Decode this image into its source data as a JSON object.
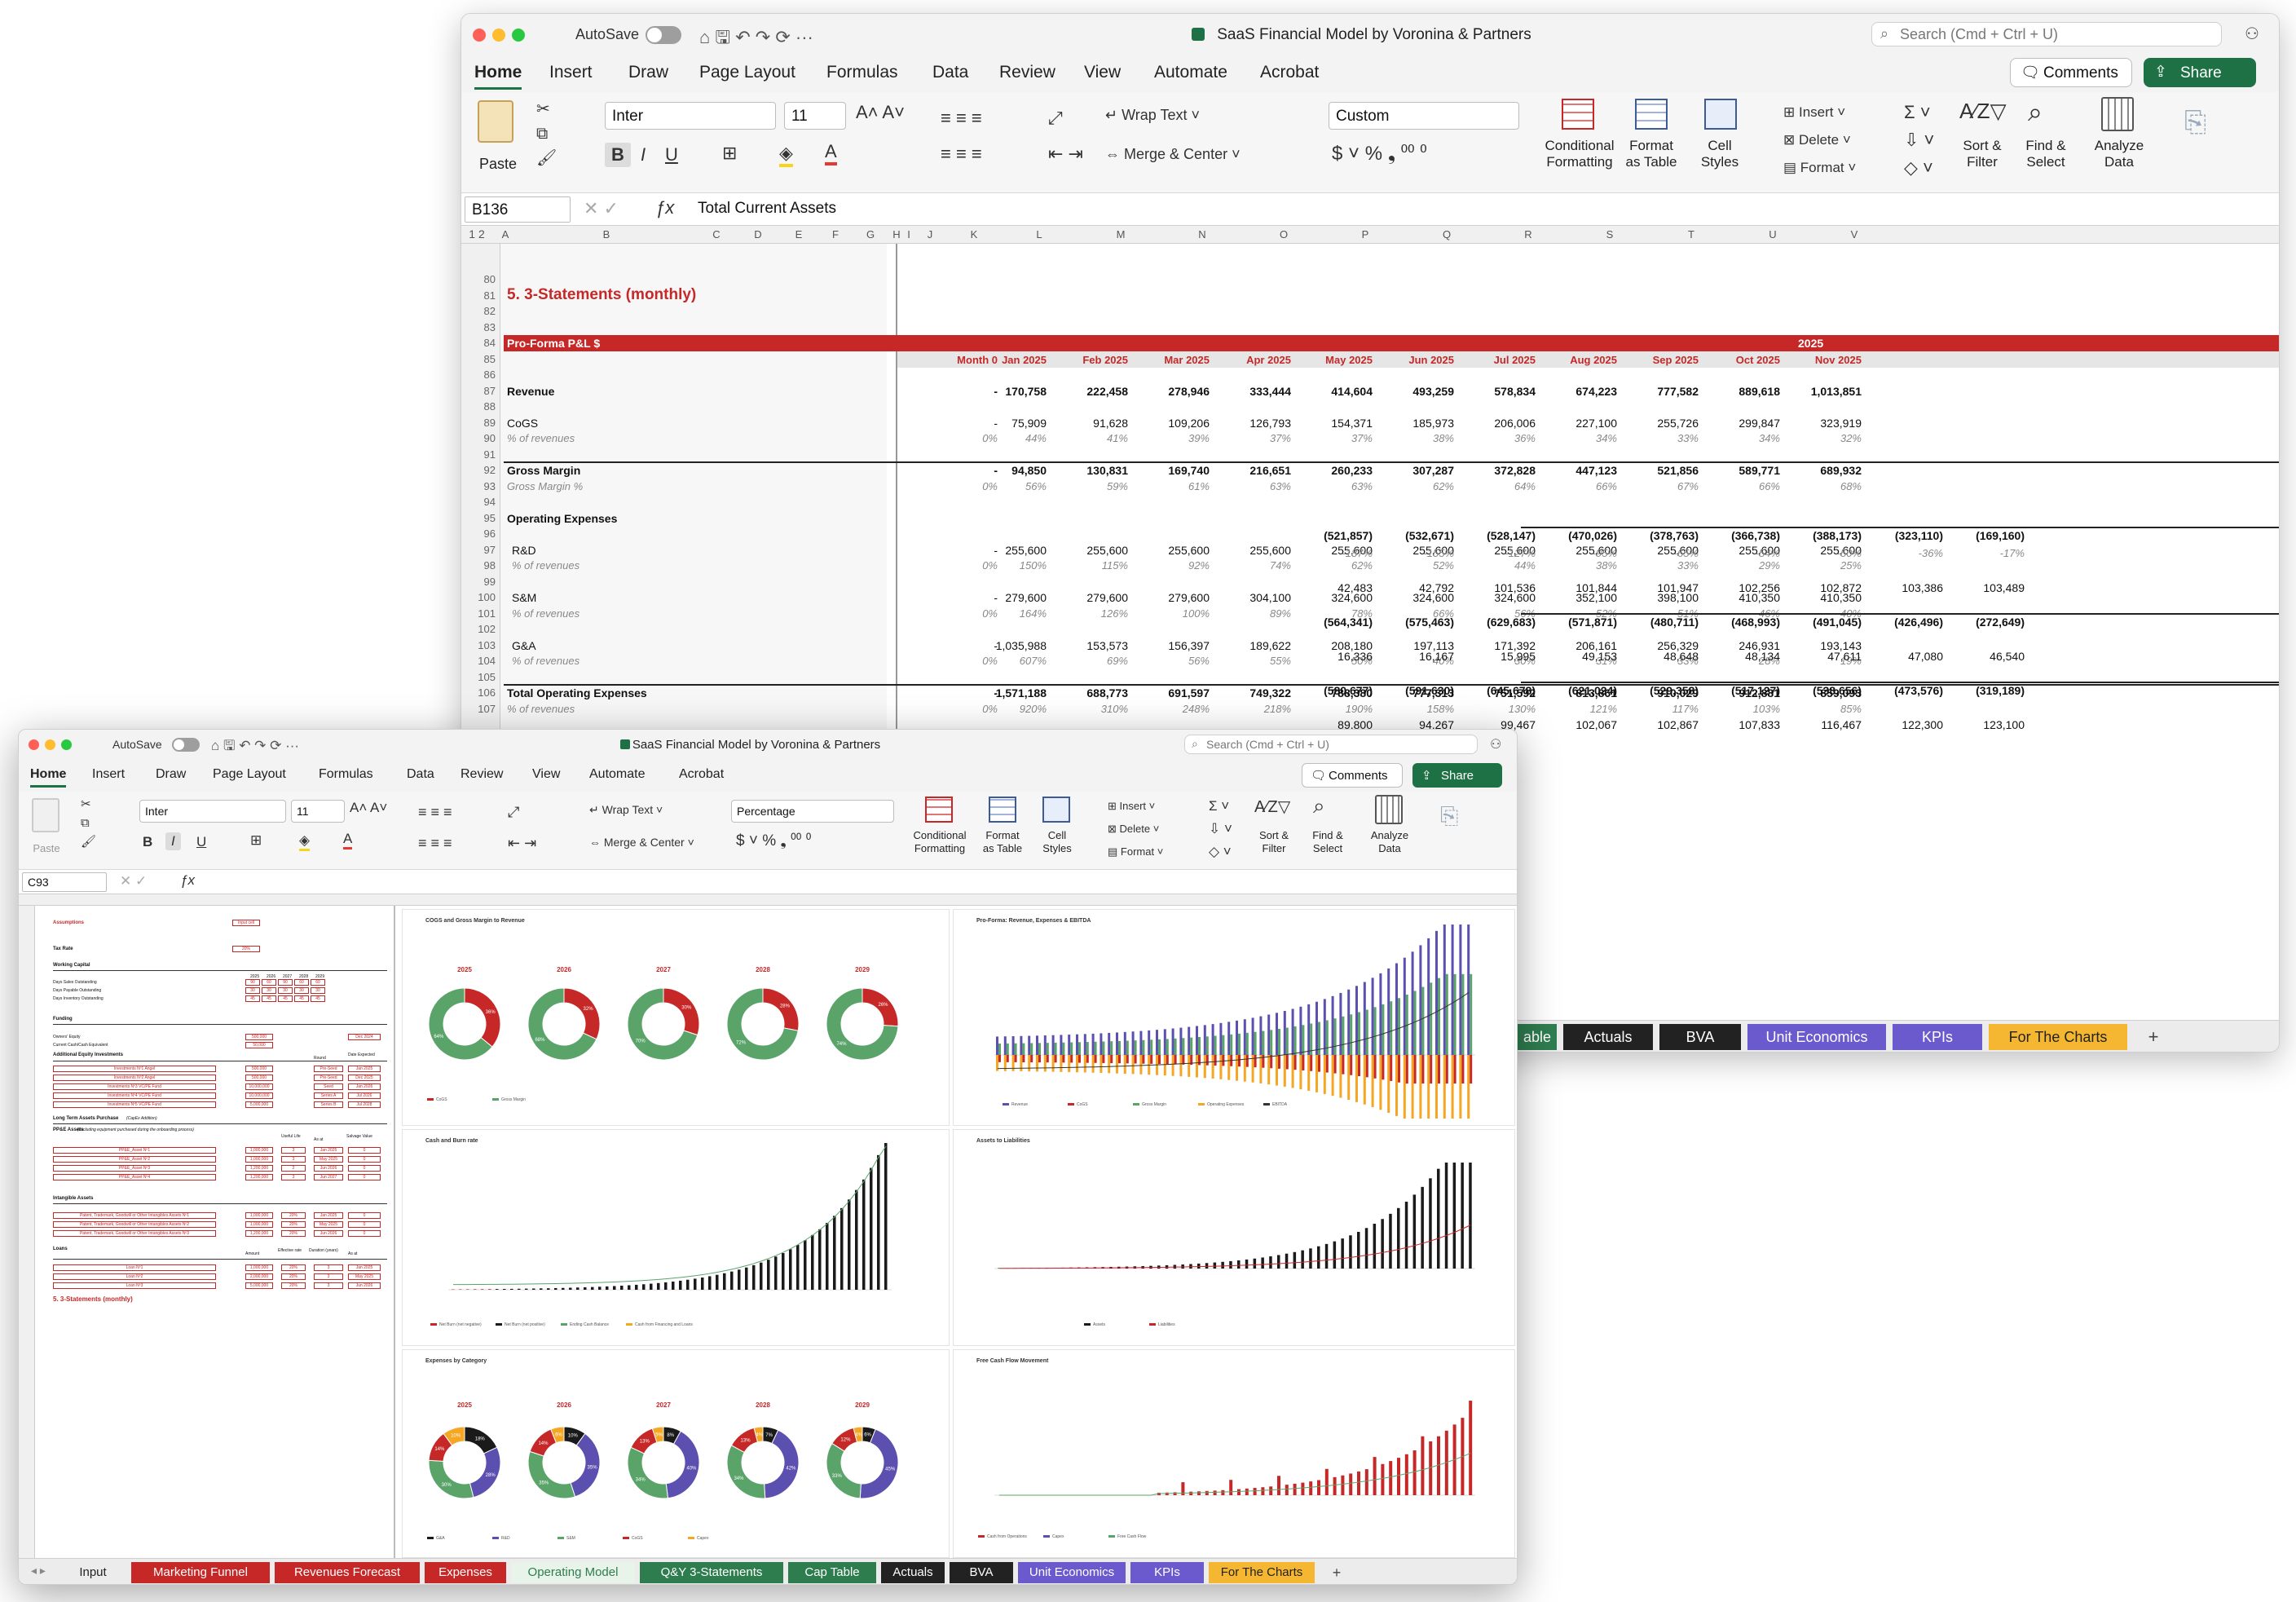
{
  "app": {
    "title": "SaaS Financial Model by Voronina & Partners",
    "autosave": "AutoSave",
    "search_placeholder": "Search (Cmd + Ctrl + U)",
    "comments": "Comments",
    "share": "Share"
  },
  "ribbon_tabs": [
    "Home",
    "Insert",
    "Draw",
    "Page Layout",
    "Formulas",
    "Data",
    "Review",
    "View",
    "Automate",
    "Acrobat"
  ],
  "ribbon": {
    "paste": "Paste",
    "font": "Inter",
    "size": "11",
    "wrap": "Wrap Text",
    "merge": "Merge & Center",
    "cond": "Conditional",
    "cond2": "Formatting",
    "fmt_table": "Format",
    "fmt_table2": "as Table",
    "styles": "Cell",
    "styles2": "Styles",
    "insert": "Insert",
    "delete": "Delete",
    "format": "Format",
    "sort": "Sort &",
    "sort2": "Filter",
    "find": "Find &",
    "find2": "Select",
    "analyze": "Analyze",
    "analyze2": "Data"
  },
  "winA": {
    "number_format": "Custom",
    "name_box": "B136",
    "formula": "Total Current Assets",
    "columns": [
      "A",
      "B",
      "C",
      "D",
      "E",
      "F",
      "G",
      "H",
      "I",
      "J",
      "K",
      "L",
      "M",
      "N",
      "O",
      "P",
      "Q",
      "R",
      "S",
      "T",
      "U",
      "V"
    ],
    "section_title": "5. 3-Statements (monthly)",
    "header_label": "Pro-Forma P&L $",
    "year": "2025",
    "months": [
      "Month 0",
      "Jan 2025",
      "Feb 2025",
      "Mar 2025",
      "Apr 2025",
      "May 2025",
      "Jun 2025",
      "Jul 2025",
      "Aug 2025",
      "Sep 2025",
      "Oct 2025",
      "Nov 2025"
    ],
    "rows": [
      {
        "n": "80"
      },
      {
        "n": "81"
      },
      {
        "n": "82"
      },
      {
        "n": "83"
      },
      {
        "n": "84"
      },
      {
        "n": "85"
      },
      {
        "n": "86"
      },
      {
        "n": "87",
        "label": "Revenue",
        "bold": true,
        "vals": [
          "-",
          "170,758",
          "222,458",
          "278,946",
          "333,444",
          "414,604",
          "493,259",
          "578,834",
          "674,223",
          "777,582",
          "889,618",
          "1,013,851"
        ]
      },
      {
        "n": "88"
      },
      {
        "n": "89",
        "label": "CoGS",
        "vals": [
          "-",
          "75,909",
          "91,628",
          "109,206",
          "126,793",
          "154,371",
          "185,973",
          "206,006",
          "227,100",
          "255,726",
          "299,847",
          "323,919"
        ]
      },
      {
        "n": "90",
        "label": "% of revenues",
        "pct": true,
        "vals": [
          "0%",
          "44%",
          "41%",
          "39%",
          "37%",
          "37%",
          "38%",
          "36%",
          "34%",
          "33%",
          "34%",
          "32%"
        ]
      },
      {
        "n": "91"
      },
      {
        "n": "92",
        "label": "Gross Margin",
        "bold": true,
        "line": true,
        "vals": [
          "-",
          "94,850",
          "130,831",
          "169,740",
          "216,651",
          "260,233",
          "307,287",
          "372,828",
          "447,123",
          "521,856",
          "589,771",
          "689,932"
        ]
      },
      {
        "n": "93",
        "label": "Gross Margin %",
        "pct": true,
        "vals": [
          "0%",
          "56%",
          "59%",
          "61%",
          "63%",
          "63%",
          "62%",
          "64%",
          "66%",
          "67%",
          "66%",
          "68%"
        ]
      },
      {
        "n": "94"
      },
      {
        "n": "95",
        "label": "Operating Expenses",
        "bold": true
      },
      {
        "n": "96"
      },
      {
        "n": "97",
        "label": "R&D",
        "indent": true,
        "vals": [
          "-",
          "255,600",
          "255,600",
          "255,600",
          "255,600",
          "255,600",
          "255,600",
          "255,600",
          "255,600",
          "255,600",
          "255,600",
          "255,600"
        ]
      },
      {
        "n": "98",
        "label": "% of revenues",
        "pct": true,
        "indent": true,
        "vals": [
          "0%",
          "150%",
          "115%",
          "92%",
          "74%",
          "62%",
          "52%",
          "44%",
          "38%",
          "33%",
          "29%",
          "25%"
        ]
      },
      {
        "n": "99"
      },
      {
        "n": "100",
        "label": "S&M",
        "indent": true,
        "vals": [
          "-",
          "279,600",
          "279,600",
          "279,600",
          "304,100",
          "324,600",
          "324,600",
          "324,600",
          "352,100",
          "398,100",
          "410,350",
          "410,350"
        ]
      },
      {
        "n": "101",
        "label": "% of revenues",
        "pct": true,
        "indent": true,
        "vals": [
          "0%",
          "164%",
          "126%",
          "100%",
          "89%",
          "78%",
          "66%",
          "56%",
          "52%",
          "51%",
          "46%",
          "40%"
        ]
      },
      {
        "n": "102"
      },
      {
        "n": "103",
        "label": "G&A",
        "indent": true,
        "vals": [
          "-",
          "1,035,988",
          "153,573",
          "156,397",
          "189,622",
          "208,180",
          "197,113",
          "171,392",
          "206,161",
          "256,329",
          "246,931",
          "193,143"
        ]
      },
      {
        "n": "104",
        "label": "% of revenues",
        "pct": true,
        "indent": true,
        "vals": [
          "0%",
          "607%",
          "69%",
          "56%",
          "55%",
          "50%",
          "40%",
          "30%",
          "31%",
          "33%",
          "28%",
          "19%"
        ]
      },
      {
        "n": "105"
      },
      {
        "n": "106",
        "label": "Total Operating Expenses",
        "bold": true,
        "line": true,
        "vals": [
          "-",
          "1,571,188",
          "688,773",
          "691,597",
          "749,322",
          "788,380",
          "777,313",
          "751,592",
          "813,861",
          "910,029",
          "912,881",
          "859,093"
        ]
      },
      {
        "n": "107",
        "label": "% of revenues",
        "pct": true,
        "vals": [
          "0%",
          "920%",
          "310%",
          "248%",
          "218%",
          "190%",
          "158%",
          "130%",
          "121%",
          "117%",
          "103%",
          "85%"
        ]
      }
    ],
    "hidden_rows": [
      {
        "bold": true,
        "line": true,
        "vals": [
          "(521,857)",
          "(532,671)",
          "(528,147)",
          "(470,026)",
          "(378,763)",
          "(366,738)",
          "(388,173)",
          "(323,110)",
          "(169,160)"
        ]
      },
      {
        "pct": true,
        "vals": [
          "-187%",
          "-155%",
          "-127%",
          "-95%",
          "-65%",
          "-54%",
          "-50%",
          "-36%",
          "-17%"
        ]
      },
      {
        "vals": [
          "42,483",
          "42,792",
          "101,536",
          "101,844",
          "101,947",
          "102,256",
          "102,872",
          "103,386",
          "103,489"
        ]
      },
      {
        "bold": true,
        "line": true,
        "vals": [
          "(564,341)",
          "(575,463)",
          "(629,683)",
          "(571,871)",
          "(480,711)",
          "(468,993)",
          "(491,045)",
          "(426,496)",
          "(272,649)"
        ]
      },
      {
        "vals": [
          "16,336",
          "16,167",
          "15,995",
          "49,153",
          "48,648",
          "48,134",
          "47,611",
          "47,080",
          "46,540"
        ]
      },
      {
        "bold": true,
        "line": true,
        "vals": [
          "(580,677)",
          "(591,630)",
          "(645,678)",
          "(621,024)",
          "(529,358)",
          "(517,127)",
          "(538,656)",
          "(473,576)",
          "(319,189)"
        ]
      },
      {
        "vals": [
          "89,800",
          "94,267",
          "99,467",
          "102,067",
          "102,867",
          "107,833",
          "116,467",
          "122,300",
          "123,100"
        ]
      },
      {
        "bold": true,
        "line": true,
        "vals": [
          "(670,477)",
          "(685,897)",
          "(745,145)",
          "(723,091)",
          "(632,225)",
          "(624,961)",
          "(655,123)",
          "(595,876)",
          "(442,289)"
        ]
      }
    ],
    "tabs": [
      {
        "label": "able",
        "color": "#2e7d4f"
      },
      {
        "label": "Actuals",
        "color": "#222222"
      },
      {
        "label": "BVA",
        "color": "#222222"
      },
      {
        "label": "Unit Economics",
        "color": "#6a5acd"
      },
      {
        "label": "KPIs",
        "color": "#6a5acd"
      },
      {
        "label": "For The Charts",
        "color": "#f5b731"
      }
    ]
  },
  "winB": {
    "number_format": "Percentage",
    "name_box": "C93",
    "tabs": [
      {
        "label": "Input",
        "color": "#ececec",
        "text": "#222"
      },
      {
        "label": "Marketing Funnel",
        "color": "#c62828",
        "text": "#fff"
      },
      {
        "label": "Revenues Forecast",
        "color": "#c62828",
        "text": "#fff"
      },
      {
        "label": "Expenses",
        "color": "#c62828",
        "text": "#fff"
      },
      {
        "label": "Operating Model",
        "color": "#e8f3ea",
        "text": "#2e7d4f"
      },
      {
        "label": "Q&Y 3-Statements",
        "color": "#2e7d4f",
        "text": "#fff"
      },
      {
        "label": "Cap Table",
        "color": "#2e7d4f",
        "text": "#fff"
      },
      {
        "label": "Actuals",
        "color": "#222222",
        "text": "#fff"
      },
      {
        "label": "BVA",
        "color": "#222222",
        "text": "#fff"
      },
      {
        "label": "Unit Economics",
        "color": "#6a5acd",
        "text": "#fff"
      },
      {
        "label": "KPIs",
        "color": "#6a5acd",
        "text": "#fff"
      },
      {
        "label": "For The Charts",
        "color": "#f5b731",
        "text": "#222"
      }
    ],
    "assumptions": {
      "title": "Assumptions",
      "input_cell": "Input cell",
      "tax_rate": "Tax Rate",
      "tax_val": "20%",
      "working_capital": "Working Capital",
      "years": [
        "2025",
        "2026",
        "2027",
        "2028",
        "2029"
      ],
      "wc_rows": [
        {
          "label": "Days Sales Outstanding",
          "vals": [
            "90",
            "60",
            "90",
            "60",
            "60"
          ]
        },
        {
          "label": "Days Payable Outstanding",
          "vals": [
            "30",
            "30",
            "30",
            "30",
            "30"
          ]
        },
        {
          "label": "Days Inventory Outstanding",
          "vals": [
            "45",
            "45",
            "45",
            "45",
            "45"
          ]
        }
      ],
      "funding": "Funding",
      "owners_equity": "Owners' Equity",
      "owners_val": "500,000",
      "current_cash": "Current Cash/Cash Equivalent",
      "cash_val": "50,000",
      "asat": "Dec 2024",
      "additional": "Additional Equity Investments",
      "round_hdr": "Round",
      "date_hdr": "Date Expected",
      "investments": [
        {
          "label": "Investments Nº1 Angel",
          "amt": "500,000",
          "round": "Pre-Seed",
          "date": "Jan 2025"
        },
        {
          "label": "Investments Nº2 Angel",
          "amt": "500,000",
          "round": "Pre-Seed",
          "date": "Dec 2025"
        },
        {
          "label": "Investments Nº3 VC/PE Fund",
          "amt": "10,000,000",
          "round": "Seed",
          "date": "Jan 2026"
        },
        {
          "label": "Investments Nº4 VC/PE Fund",
          "amt": "10,000,000",
          "round": "Series A",
          "date": "Jul 2026"
        },
        {
          "label": "Investments Nº5 VC/PE Fund",
          "amt": "5,000,000",
          "round": "Series B",
          "date": "Jul 2028"
        }
      ],
      "ltap": "Long Term Assets Purchase",
      "ltap_note": "(CapEx Addition)",
      "ppe": "PP&E Assets",
      "ppe_note": "(excluding equipment purchased during the onboarding process)",
      "useful": "Useful Life",
      "asat2": "As at",
      "salvage": "Salvage Value",
      "ppe_rows": [
        {
          "label": "PP&E_Asset Nº1",
          "amt": "1,000,000",
          "life": "3",
          "date": "Jan 2025",
          "sv": "0"
        },
        {
          "label": "PP&E_Asset Nº2",
          "amt": "1,000,000",
          "life": "3",
          "date": "May 2025",
          "sv": "0"
        },
        {
          "label": "PP&E_Asset Nº3",
          "amt": "1,200,000",
          "life": "2",
          "date": "Jun 2026",
          "sv": "0"
        },
        {
          "label": "PP&E_Asset Nº4",
          "amt": "1,200,000",
          "life": "3",
          "date": "Jun 2027",
          "sv": "0"
        }
      ],
      "intangible": "Intangible Assets",
      "int_rows": [
        {
          "label": "Patent, Trademark, Goodwill or Other Intangibles Assets Nº1",
          "amt": "1,000,000",
          "life": "20%",
          "date": "Jan 2025",
          "sv": "0"
        },
        {
          "label": "Patent, Trademark, Goodwill or Other Intangibles Assets Nº2",
          "amt": "1,000,000",
          "life": "20%",
          "date": "May 2025",
          "sv": "0"
        },
        {
          "label": "Patent, Trademark, Goodwill or Other Intangibles Assets Nº3",
          "amt": "1,200,000",
          "life": "20%",
          "date": "Jun 2026",
          "sv": "0"
        }
      ],
      "loans": "Loans",
      "amount": "Amount",
      "eff": "Effective rate",
      "dur": "Duration (years)",
      "asat3": "As at",
      "loan_rows": [
        {
          "label": "Loan Nº1",
          "amt": "1,000,000",
          "rate": "20%",
          "dur": "3",
          "date": "Jan 2025"
        },
        {
          "label": "Loan Nº2",
          "amt": "2,000,000",
          "rate": "20%",
          "dur": "3",
          "date": "May 2025"
        },
        {
          "label": "Loan Nº3",
          "amt": "5,000,000",
          "rate": "20%",
          "dur": "3",
          "date": "Jun 2026"
        }
      ],
      "footer_title": "5. 3-Statements (monthly)"
    },
    "charts": {
      "donut1_title": "COGS and Gross Margin to Revenue",
      "donut1_legend": [
        "CoGS",
        "Gross Margin"
      ],
      "donut1": [
        {
          "year": "2025",
          "cogs": 36,
          "gm": 64
        },
        {
          "year": "2026",
          "cogs": 32,
          "gm": 68
        },
        {
          "year": "2027",
          "cogs": 30,
          "gm": 70
        },
        {
          "year": "2028",
          "cogs": 28,
          "gm": 72
        },
        {
          "year": "2029",
          "cogs": 26,
          "gm": 74
        }
      ],
      "proforma_title": "Pro-Forma: Revenue, Expenses & EBITDA",
      "proforma_legend": [
        "Revenue",
        "CoGS",
        "Gross Margin",
        "Operating Expenses",
        "EBITDA"
      ],
      "cash_title": "Cash and Burn rate",
      "cash_legend": [
        "Net Burn (net negative)",
        "Net Burn (net positive)",
        "Ending Cash Balance",
        "Cash from Financing and Loans"
      ],
      "assets_title": "Assets to Liabilities",
      "assets_legend": [
        "Assets",
        "Liabilities"
      ],
      "expcat_title": "Expenses by Category",
      "expcat_legend": [
        "G&A",
        "R&D",
        "S&M",
        "CoGS",
        "Capex"
      ],
      "donut2": [
        {
          "year": "2025",
          "vals": [
            18,
            28,
            30,
            14,
            10
          ]
        },
        {
          "year": "2026",
          "vals": [
            10,
            35,
            35,
            14,
            6
          ]
        },
        {
          "year": "2027",
          "vals": [
            8,
            40,
            34,
            13,
            5
          ]
        },
        {
          "year": "2028",
          "vals": [
            7,
            42,
            34,
            13,
            4
          ]
        },
        {
          "year": "2029",
          "vals": [
            6,
            45,
            33,
            12,
            4
          ]
        }
      ],
      "fcf_title": "Free Cash Flow Movement",
      "fcf_legend": [
        "Cash from Operations",
        "Capex",
        "Free Cash Flow"
      ]
    }
  },
  "colors": {
    "brand_green": "#1e7145",
    "header_red": "#c62828",
    "cogs_red": "#c62828",
    "gm_green": "#5aa46a",
    "purple": "#5b4fb0",
    "orange": "#f5a623",
    "black": "#1a1a1a"
  }
}
